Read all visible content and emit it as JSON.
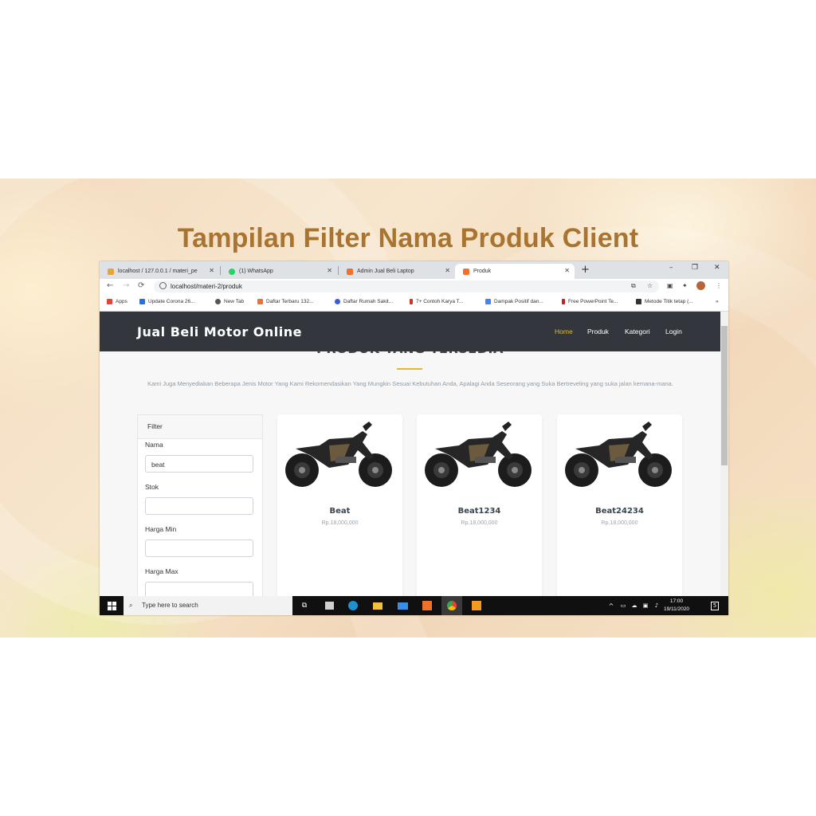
{
  "slide": {
    "title": "Tampilan Filter Nama Produk Client"
  },
  "browser": {
    "tabs": [
      {
        "label": "localhost / 127.0.0.1 / materi_pe",
        "close": "✕",
        "color": "#e8a33a"
      },
      {
        "label": "(1) WhatsApp",
        "close": "✕",
        "color": "#25d366"
      },
      {
        "label": "Admin Jual Beli Laptop",
        "close": "✕",
        "color": "#f0722a"
      },
      {
        "label": "Produk",
        "close": "✕",
        "color": "#f0722a"
      }
    ],
    "new_tab": "+",
    "window_controls": {
      "minimize": "–",
      "maximize": "❐",
      "close": "✕"
    },
    "url": "localhost/materi-2/produk",
    "bookmarks": [
      {
        "label": "Apps",
        "color": "#ea4335"
      },
      {
        "label": "Update Corona 26...",
        "color": "#1a73e8"
      },
      {
        "label": "New Tab",
        "color": "#555555"
      },
      {
        "label": "Daftar Terbaru 132...",
        "color": "#f0722a"
      },
      {
        "label": "Daftar Rumah Sakit...",
        "color": "#3b5bdb"
      },
      {
        "label": "7+ Contoh Karya T...",
        "color": "#d93025"
      },
      {
        "label": "Dampak Positif dan...",
        "color": "#4285f4"
      },
      {
        "label": "Free PowerPoint Te...",
        "color": "#c5221f"
      },
      {
        "label": "Metode Titik tetap (...",
        "color": "#333333"
      }
    ],
    "bookmarks_more": "»"
  },
  "site": {
    "brand": "Jual Beli Motor Online",
    "menu": [
      "Home",
      "Produk",
      "Kategori",
      "Login"
    ],
    "active_menu": "Home",
    "page_title": "PRODUK YANG TERSEDIA",
    "description": "Kami Juga Menyediakan Beberapa Jenis Motor Yang Kami Rekomendasikan Yang Mungkin Sesuai Kebutuhan Anda, Apalagi Anda Seseorang yang Suka Bertreveling yang suka jalan kemana-mana.",
    "filter": {
      "header": "Filter",
      "fields": [
        {
          "label": "Nama",
          "value": "beat"
        },
        {
          "label": "Stok",
          "value": ""
        },
        {
          "label": "Harga Min",
          "value": ""
        },
        {
          "label": "Harga Max",
          "value": ""
        }
      ]
    },
    "products": [
      {
        "name": "Beat",
        "price": "Rp.18,000,000"
      },
      {
        "name": "Beat1234",
        "price": "Rp.18,000,000"
      },
      {
        "name": "Beat24234",
        "price": "Rp.18,000,000"
      }
    ]
  },
  "taskbar": {
    "search_placeholder": "Type here to search",
    "time": "17:00",
    "date": "19/11/2020",
    "notification_count": "5"
  },
  "colors": {
    "accent": "#e0b92c",
    "navbar": "#33373d",
    "title": "#a8742f"
  }
}
